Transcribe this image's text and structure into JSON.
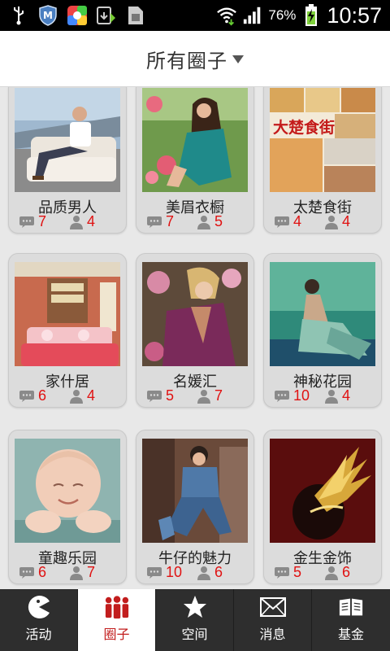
{
  "status_bar": {
    "battery_percent": "76%",
    "time": "10:57"
  },
  "header": {
    "title": "所有圈子"
  },
  "circles": [
    {
      "name": "品质男人",
      "comments": "7",
      "members": "4"
    },
    {
      "name": "美眉衣橱",
      "comments": "7",
      "members": "5"
    },
    {
      "name": "太楚食街",
      "comments": "4",
      "members": "4"
    },
    {
      "name": "家什居",
      "comments": "6",
      "members": "4"
    },
    {
      "name": "名媛汇",
      "comments": "5",
      "members": "7"
    },
    {
      "name": "神秘花园",
      "comments": "10",
      "members": "4"
    },
    {
      "name": "童趣乐园",
      "comments": "6",
      "members": "7"
    },
    {
      "name": "牛仔的魅力",
      "comments": "10",
      "members": "6"
    },
    {
      "name": "金生金饰",
      "comments": "5",
      "members": "6"
    }
  ],
  "food_image_text": "大楚食街",
  "bottom_nav": [
    {
      "label": "活动",
      "icon": "pacman-icon",
      "active": false
    },
    {
      "label": "圈子",
      "icon": "people-icon",
      "active": true
    },
    {
      "label": "空间",
      "icon": "star-icon",
      "active": false
    },
    {
      "label": "消息",
      "icon": "envelope-icon",
      "active": false
    },
    {
      "label": "基金",
      "icon": "book-icon",
      "active": false
    }
  ],
  "colors": {
    "count_red": "#e01212",
    "active_tab_red": "#c21d1d",
    "nav_background": "#2e2e2e"
  }
}
